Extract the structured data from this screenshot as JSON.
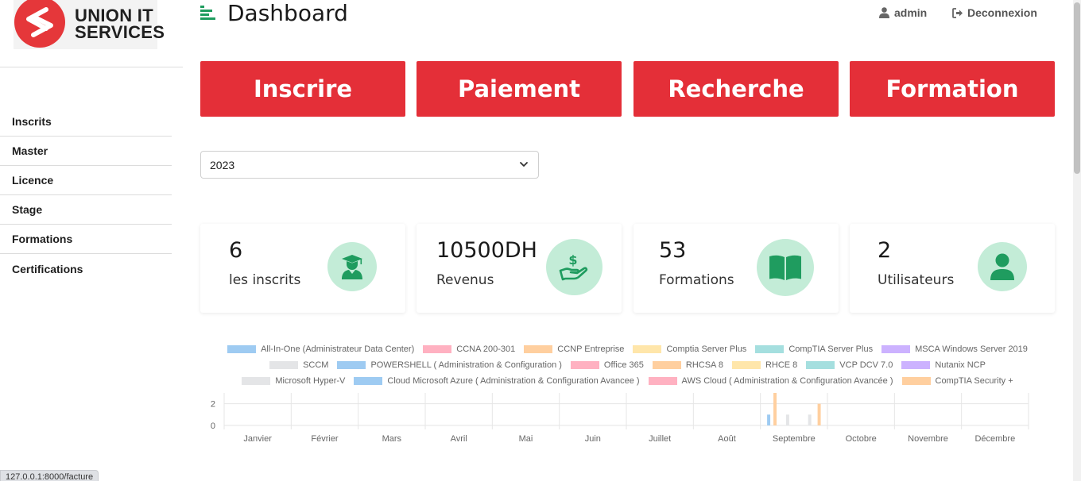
{
  "brand": {
    "line1": "UNION IT",
    "line2": "SERVICES"
  },
  "sidebar": {
    "items": [
      {
        "label": "Inscrits"
      },
      {
        "label": "Master"
      },
      {
        "label": "Licence"
      },
      {
        "label": "Stage"
      },
      {
        "label": "Formations"
      },
      {
        "label": "Certifications"
      }
    ]
  },
  "header": {
    "title": "Dashboard",
    "user_label": "admin",
    "logout_label": "Deconnexion"
  },
  "actions": [
    {
      "label": "Inscrire"
    },
    {
      "label": "Paiement"
    },
    {
      "label": "Recherche"
    },
    {
      "label": "Formation"
    }
  ],
  "year_select": {
    "value": "2023"
  },
  "stats": [
    {
      "value": "6",
      "label": "les inscrits",
      "icon": "graduate-icon"
    },
    {
      "value": "10500DH",
      "label": "Revenus",
      "icon": "money-hand-icon"
    },
    {
      "value": "53",
      "label": "Formations",
      "icon": "book-icon"
    },
    {
      "value": "2",
      "label": "Utilisateurs",
      "icon": "user-icon"
    }
  ],
  "colors": {
    "accent": "#e42f38",
    "icon_bg": "#c3ecd7",
    "icon_fg": "#1f9c5f",
    "hamburger": "#1f9c5f"
  },
  "status_url": "127.0.0.1:8000/facture",
  "chart_data": {
    "type": "bar",
    "categories": [
      "Janvier",
      "Février",
      "Mars",
      "Avril",
      "Mai",
      "Juin",
      "Juillet",
      "Août",
      "Septembre",
      "Octobre",
      "Novembre",
      "Décembre"
    ],
    "ylim": [
      0,
      3
    ],
    "yticks": [
      0,
      2
    ],
    "legend_position": "top",
    "legend_rows": [
      [
        0,
        1,
        2,
        3,
        4,
        5
      ],
      [
        6,
        7,
        8,
        9,
        10,
        11,
        12
      ],
      [
        13,
        14,
        15,
        16
      ]
    ],
    "series": [
      {
        "name": "All-In-One (Administrateur Data Center)",
        "color": "#9ecbf2",
        "values": [
          0,
          0,
          0,
          0,
          0,
          0,
          0,
          0,
          1,
          0,
          0,
          0
        ]
      },
      {
        "name": "CCNA 200-301",
        "color": "#ffb1c1",
        "values": [
          0,
          0,
          0,
          0,
          0,
          0,
          0,
          0,
          0,
          0,
          0,
          0
        ]
      },
      {
        "name": "CCNP Entreprise",
        "color": "#ffcf9f",
        "values": [
          0,
          0,
          0,
          0,
          0,
          0,
          0,
          0,
          3,
          0,
          0,
          0
        ]
      },
      {
        "name": "Comptia Server Plus",
        "color": "#ffe6aa",
        "values": [
          0,
          0,
          0,
          0,
          0,
          0,
          0,
          0,
          0,
          0,
          0,
          0
        ]
      },
      {
        "name": "CompTIA Server Plus",
        "color": "#a5dfdf",
        "values": [
          0,
          0,
          0,
          0,
          0,
          0,
          0,
          0,
          0,
          0,
          0,
          0
        ]
      },
      {
        "name": "MSCA Windows Server 2019",
        "color": "#ccb2ff",
        "values": [
          0,
          0,
          0,
          0,
          0,
          0,
          0,
          0,
          0,
          0,
          0,
          0
        ]
      },
      {
        "name": "SCCM",
        "color": "#e4e5e7",
        "values": [
          0,
          0,
          0,
          0,
          0,
          0,
          0,
          0,
          1,
          0,
          0,
          0
        ]
      },
      {
        "name": "POWERSHELL ( Administration & Configuration )",
        "color": "#9ecbf2",
        "values": [
          0,
          0,
          0,
          0,
          0,
          0,
          0,
          0,
          0,
          0,
          0,
          0
        ]
      },
      {
        "name": "Office 365",
        "color": "#ffb1c1",
        "values": [
          0,
          0,
          0,
          0,
          0,
          0,
          0,
          0,
          0,
          0,
          0,
          0
        ]
      },
      {
        "name": "RHCSA 8",
        "color": "#ffcf9f",
        "values": [
          0,
          0,
          0,
          0,
          0,
          0,
          0,
          0,
          0,
          0,
          0,
          0
        ]
      },
      {
        "name": "RHCE 8",
        "color": "#ffe6aa",
        "values": [
          0,
          0,
          0,
          0,
          0,
          0,
          0,
          0,
          0,
          0,
          0,
          0
        ]
      },
      {
        "name": "VCP DCV 7.0",
        "color": "#a5dfdf",
        "values": [
          0,
          0,
          0,
          0,
          0,
          0,
          0,
          0,
          0,
          0,
          0,
          0
        ]
      },
      {
        "name": "Nutanix NCP",
        "color": "#ccb2ff",
        "values": [
          0,
          0,
          0,
          0,
          0,
          0,
          0,
          0,
          0,
          0,
          0,
          0
        ]
      },
      {
        "name": "Microsoft Hyper-V",
        "color": "#e4e5e7",
        "values": [
          0,
          0,
          0,
          0,
          0,
          0,
          0,
          0,
          1,
          0,
          0,
          0
        ]
      },
      {
        "name": "Cloud Microsoft Azure ( Administration & Configuration Avancee )",
        "color": "#9ecbf2",
        "values": [
          0,
          0,
          0,
          0,
          0,
          0,
          0,
          0,
          0,
          0,
          0,
          0
        ]
      },
      {
        "name": "AWS Cloud ( Administration & Configuration Avancée )",
        "color": "#ffb1c1",
        "values": [
          0,
          0,
          0,
          0,
          0,
          0,
          0,
          0,
          0,
          0,
          0,
          0
        ]
      },
      {
        "name": "CompTIA Security +",
        "color": "#ffcf9f",
        "values": [
          0,
          0,
          0,
          0,
          0,
          0,
          0,
          0,
          2,
          0,
          0,
          0
        ]
      }
    ]
  }
}
